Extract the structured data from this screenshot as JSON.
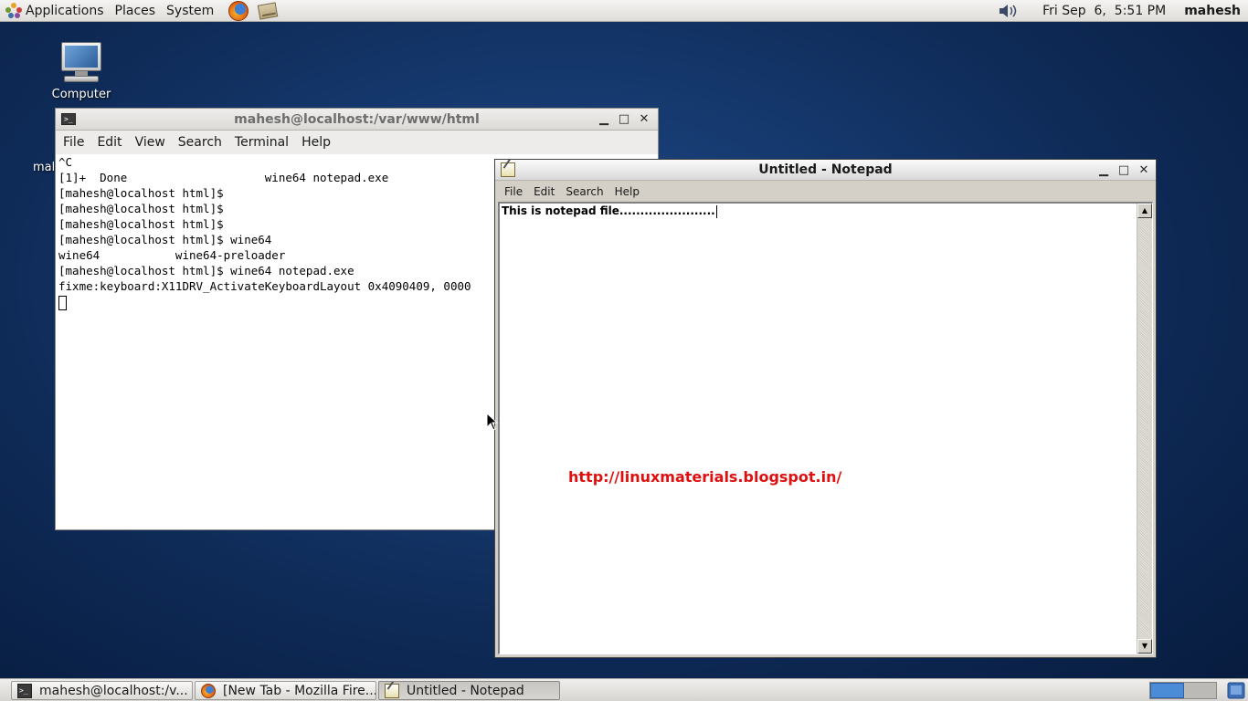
{
  "top_panel": {
    "menu_applications": "Applications",
    "menu_places": "Places",
    "menu_system": "System",
    "launchers": [
      "firefox-icon",
      "mail-icon"
    ],
    "clock": "Fri Sep  6,  5:51 PM",
    "user": "mahesh"
  },
  "desktop": {
    "icon_computer_label": "Computer",
    "partial_label": "mal"
  },
  "terminal": {
    "title": "mahesh@localhost:/var/www/html",
    "menu": [
      "File",
      "Edit",
      "View",
      "Search",
      "Terminal",
      "Help"
    ],
    "lines": [
      "^C",
      "[1]+  Done                    wine64 notepad.exe",
      "[mahesh@localhost html]$",
      "[mahesh@localhost html]$",
      "[mahesh@localhost html]$",
      "[mahesh@localhost html]$ wine64",
      "wine64           wine64-preloader",
      "[mahesh@localhost html]$ wine64 notepad.exe",
      "fixme:keyboard:X11DRV_ActivateKeyboardLayout 0x4090409, 0000"
    ]
  },
  "notepad": {
    "title": "Untitled - Notepad",
    "menu": [
      "File",
      "Edit",
      "Search",
      "Help"
    ],
    "content": "This is notepad file......................."
  },
  "watermark": "http://linuxmaterials.blogspot.in/",
  "taskbar": {
    "items": [
      {
        "label": "mahesh@localhost:/v...",
        "icon": "terminal-icon"
      },
      {
        "label": "[New Tab - Mozilla Fire...",
        "icon": "firefox-icon"
      },
      {
        "label": "Untitled - Notepad",
        "icon": "notepad-icon",
        "active": true
      }
    ]
  },
  "colors": {
    "desktop_bg": "#163a70",
    "watermark": "#e01010",
    "workspace_active": "#4c8bd6"
  }
}
